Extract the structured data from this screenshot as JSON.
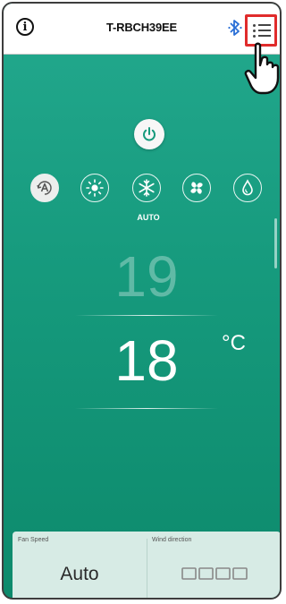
{
  "header": {
    "title": "T-RBCH39EE"
  },
  "modes": [
    {
      "name": "auto-mode",
      "selected": true
    },
    {
      "name": "heat-mode",
      "selected": false
    },
    {
      "name": "cool-mode",
      "selected": false,
      "label": "AUTO"
    },
    {
      "name": "fan-mode",
      "selected": false
    },
    {
      "name": "dry-mode",
      "selected": false
    }
  ],
  "temperature": {
    "previous": "19",
    "current": "18",
    "unit": "°C"
  },
  "fan_speed": {
    "label": "Fan Speed",
    "value": "Auto"
  },
  "wind_direction": {
    "label": "Wind direction"
  },
  "colors": {
    "background": "#169a7d",
    "highlight": "#e02b2b",
    "bluetooth": "#2a6fd6",
    "panel": "#d7ebe5"
  }
}
